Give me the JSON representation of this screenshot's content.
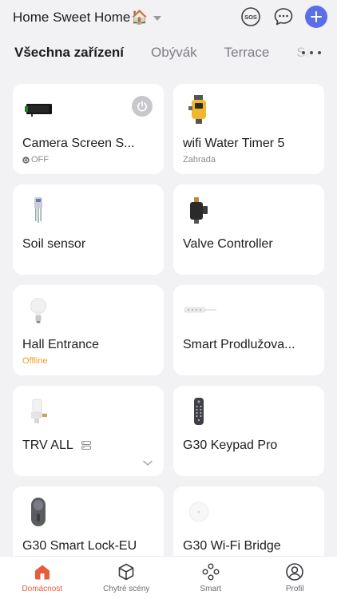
{
  "header": {
    "home_title": "Home Sweet Home",
    "home_emoji": "🏠",
    "sos_label": "SOS"
  },
  "tabs": [
    {
      "label": "Všechna zařízení",
      "active": true
    },
    {
      "label": "Obývák",
      "active": false
    },
    {
      "label": "Terrace",
      "active": false
    },
    {
      "label": "Sa",
      "active": false
    }
  ],
  "devices": [
    {
      "name": "Camera Screen S...",
      "sub": "OFF",
      "status_icon": "power-small-icon",
      "icon": "camera-screen-device-icon"
    },
    {
      "name": "wifi Water Timer 5",
      "sub": "Zahrada",
      "icon": "water-timer-device-icon"
    },
    {
      "name": "Soil sensor",
      "sub": "",
      "icon": "soil-sensor-device-icon"
    },
    {
      "name": "Valve Controller",
      "sub": "",
      "icon": "valve-controller-device-icon"
    },
    {
      "name": "Hall Entrance",
      "sub": "Offline",
      "icon": "bulb-device-icon"
    },
    {
      "name": "Smart Prodlužova...",
      "sub": "",
      "icon": "power-strip-device-icon"
    },
    {
      "name": "TRV ALL",
      "sub": "",
      "icon": "trv-device-icon"
    },
    {
      "name": "G30 Keypad Pro",
      "sub": "",
      "icon": "keypad-device-icon"
    },
    {
      "name": "G30 Smart Lock-EU",
      "sub": "",
      "icon": "smart-lock-device-icon"
    },
    {
      "name": "G30 Wi-Fi Bridge",
      "sub": "",
      "icon": "wifi-bridge-device-icon"
    }
  ],
  "nav": [
    {
      "label": "Domácnost",
      "icon": "home-icon",
      "active": true
    },
    {
      "label": "Chytré scény",
      "icon": "cube-icon",
      "active": false
    },
    {
      "label": "Smart",
      "icon": "smart-icon",
      "active": false
    },
    {
      "label": "Profil",
      "icon": "profile-icon",
      "active": false
    }
  ],
  "colors": {
    "accent": "#5a6ee8",
    "nav_active": "#e85c3c",
    "offline": "#f0a020",
    "background": "#f2f2f4"
  }
}
